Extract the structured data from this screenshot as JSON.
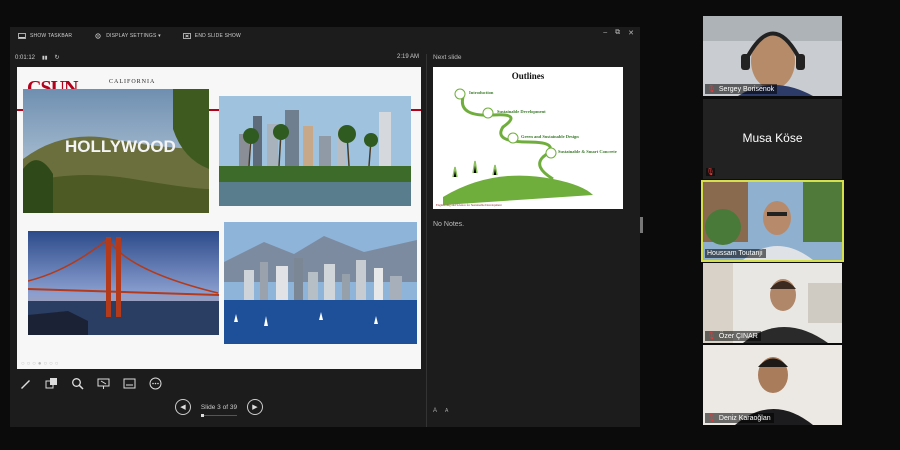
{
  "toolbar": {
    "show_taskbar": "SHOW TASKBAR",
    "display_settings": "DISPLAY SETTINGS ▾",
    "end_slide_show": "END SLIDE SHOW"
  },
  "window": {
    "minimize": "–",
    "restore": "⧉",
    "close": "✕"
  },
  "timer": {
    "elapsed": "0:01:12",
    "pause": "▮▮",
    "reset": "↻",
    "clock": "2:19 AM"
  },
  "slide": {
    "logo": "CSUN",
    "logo_sub": "CALIFORNIA",
    "hollywood": "HOLLYWOOD"
  },
  "navigation": {
    "prev": "◀",
    "next": "▶",
    "counter": "Slide 3 of 39",
    "current": 3,
    "total": 39
  },
  "next_slide": {
    "header": "Next slide",
    "title": "Outlines",
    "items": [
      "Introduction",
      "Sustainable Development",
      "Green and Sustainable Design",
      "Sustainable & Smart Concrete"
    ],
    "footer": "Engineering and Science for Sustainable Development"
  },
  "notes": {
    "text": "No Notes.",
    "font_up": "A",
    "font_down": "A"
  },
  "participants": [
    {
      "name": "Sergey Borisenok",
      "muted": true
    },
    {
      "name": "Musa Köse",
      "muted": true,
      "video": false
    },
    {
      "name": "Houssam Toutanji",
      "muted": false,
      "active": true
    },
    {
      "name": "Özer ÇINAR",
      "muted": true
    },
    {
      "name": "Deniz Karaoğlan",
      "muted": true
    }
  ],
  "icons": [
    "show-taskbar-icon",
    "display-settings-icon",
    "end-show-icon",
    "pen-icon",
    "slides-grid-icon",
    "zoom-icon",
    "pointer-icon",
    "subtitles-icon",
    "more-icon",
    "mic-muted-icon"
  ]
}
